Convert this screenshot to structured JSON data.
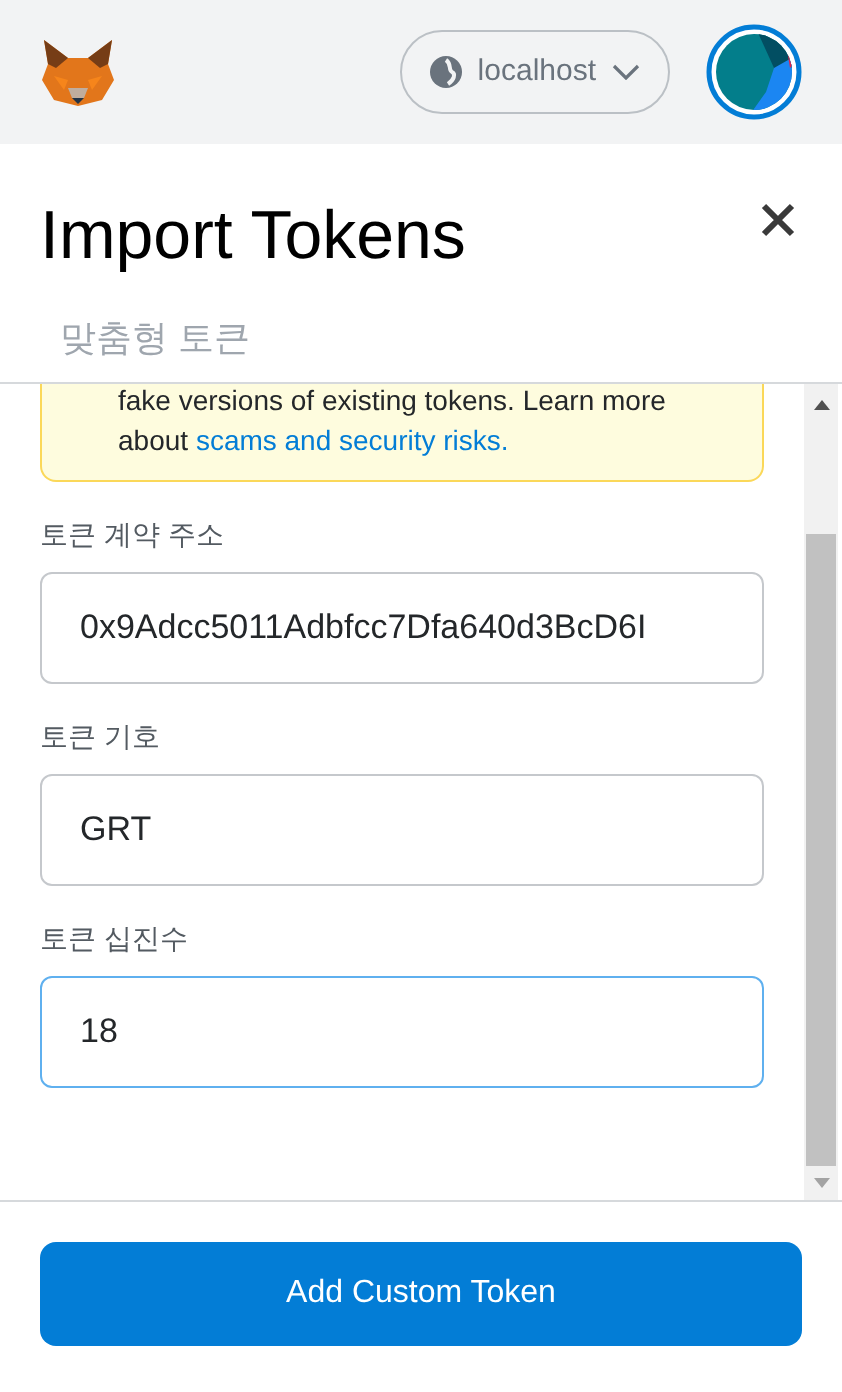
{
  "header": {
    "network": {
      "label": "localhost"
    }
  },
  "title": "Import Tokens",
  "tabs": [
    {
      "label": "맞춤형 토큰",
      "selected": false
    }
  ],
  "warning": {
    "text": "fake versions of existing tokens. Learn more about ",
    "link": "scams and security risks."
  },
  "fields": [
    {
      "label": "토큰 계약 주소",
      "value": "0x9Adcc5011Adbfcc7Dfa640d3BcD6I",
      "focused": false
    },
    {
      "label": "토큰 기호",
      "value": "GRT",
      "focused": false
    },
    {
      "label": "토큰 십진수",
      "value": "18",
      "focused": true
    }
  ],
  "button": "Add Custom Token"
}
